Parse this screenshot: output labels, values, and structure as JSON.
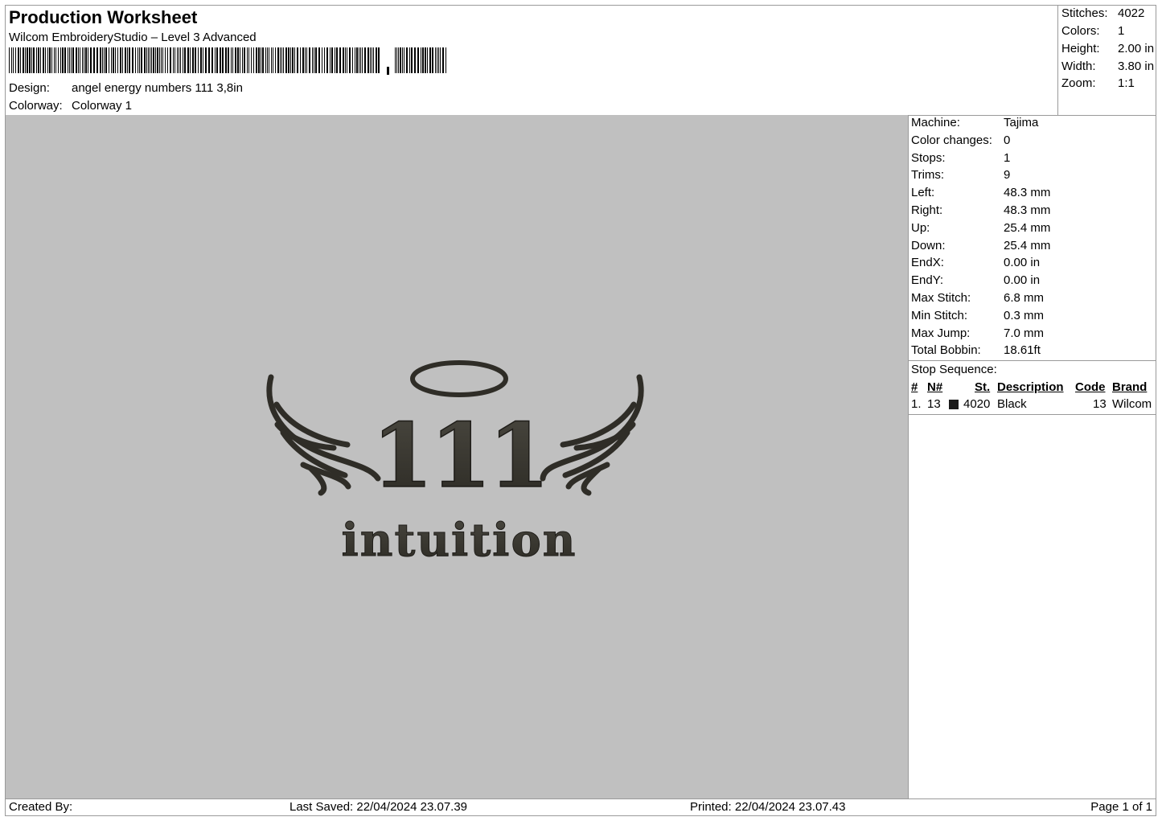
{
  "header": {
    "title": "Production Worksheet",
    "subtitle": "Wilcom EmbroideryStudio – Level 3 Advanced",
    "design_label": "Design:",
    "design_value": "angel energy numbers 111 3,8in",
    "colorway_label": "Colorway:",
    "colorway_value": "Colorway 1"
  },
  "summary": [
    {
      "label": "Stitches:",
      "value": "4022"
    },
    {
      "label": "Colors:",
      "value": "1"
    },
    {
      "label": "Height:",
      "value": "2.00 in"
    },
    {
      "label": "Width:",
      "value": "3.80 in"
    },
    {
      "label": "Zoom:",
      "value": "1:1"
    }
  ],
  "machine_info": [
    {
      "label": "Machine:",
      "value": "Tajima"
    },
    {
      "label": "Color changes:",
      "value": "0"
    },
    {
      "label": "Stops:",
      "value": "1"
    },
    {
      "label": "Trims:",
      "value": "9"
    },
    {
      "label": "Left:",
      "value": "48.3 mm"
    },
    {
      "label": "Right:",
      "value": "48.3 mm"
    },
    {
      "label": "Up:",
      "value": "25.4 mm"
    },
    {
      "label": "Down:",
      "value": "25.4 mm"
    },
    {
      "label": "EndX:",
      "value": "0.00 in"
    },
    {
      "label": "EndY:",
      "value": "0.00 in"
    },
    {
      "label": "Max Stitch:",
      "value": "6.8 mm"
    },
    {
      "label": "Min Stitch:",
      "value": "0.3 mm"
    },
    {
      "label": "Max Jump:",
      "value": "7.0 mm"
    },
    {
      "label": "Total Bobbin:",
      "value": "18.61ft"
    }
  ],
  "stop_sequence": {
    "title": "Stop Sequence:",
    "headers": {
      "num": "#",
      "n": "N#",
      "st": "St.",
      "description": "Description",
      "code": "Code",
      "brand": "Brand"
    },
    "rows": [
      {
        "num": "1.",
        "n": "13",
        "swatch_color": "#1a1a1a",
        "st": "4020",
        "description": "Black",
        "code": "13",
        "brand": "Wilcom"
      }
    ]
  },
  "design_preview": {
    "text_numbers": "111",
    "text_word": "intuition",
    "thread_color": "#37352d",
    "background_color": "#c0c0c0"
  },
  "footer": {
    "created_by": "Created By:",
    "last_saved": "Last Saved: 22/04/2024 23.07.39",
    "printed": "Printed: 22/04/2024 23.07.43",
    "page": "Page 1 of 1"
  }
}
